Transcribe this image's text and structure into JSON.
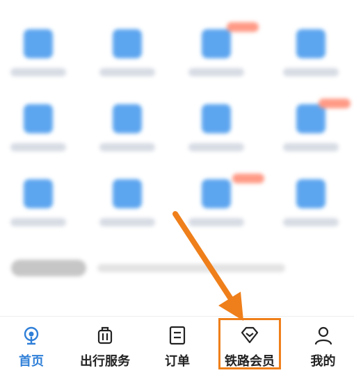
{
  "tabs": [
    {
      "label": "首页",
      "icon": "home-icon",
      "active": true
    },
    {
      "label": "出行服务",
      "icon": "luggage-icon",
      "active": false
    },
    {
      "label": "订单",
      "icon": "order-list-icon",
      "active": false
    },
    {
      "label": "铁路会员",
      "icon": "diamond-icon",
      "active": false
    },
    {
      "label": "我的",
      "icon": "person-icon",
      "active": false
    }
  ],
  "colors": {
    "accent": "#2f7fd8",
    "highlight": "#ef7f1a",
    "text": "#222222"
  }
}
